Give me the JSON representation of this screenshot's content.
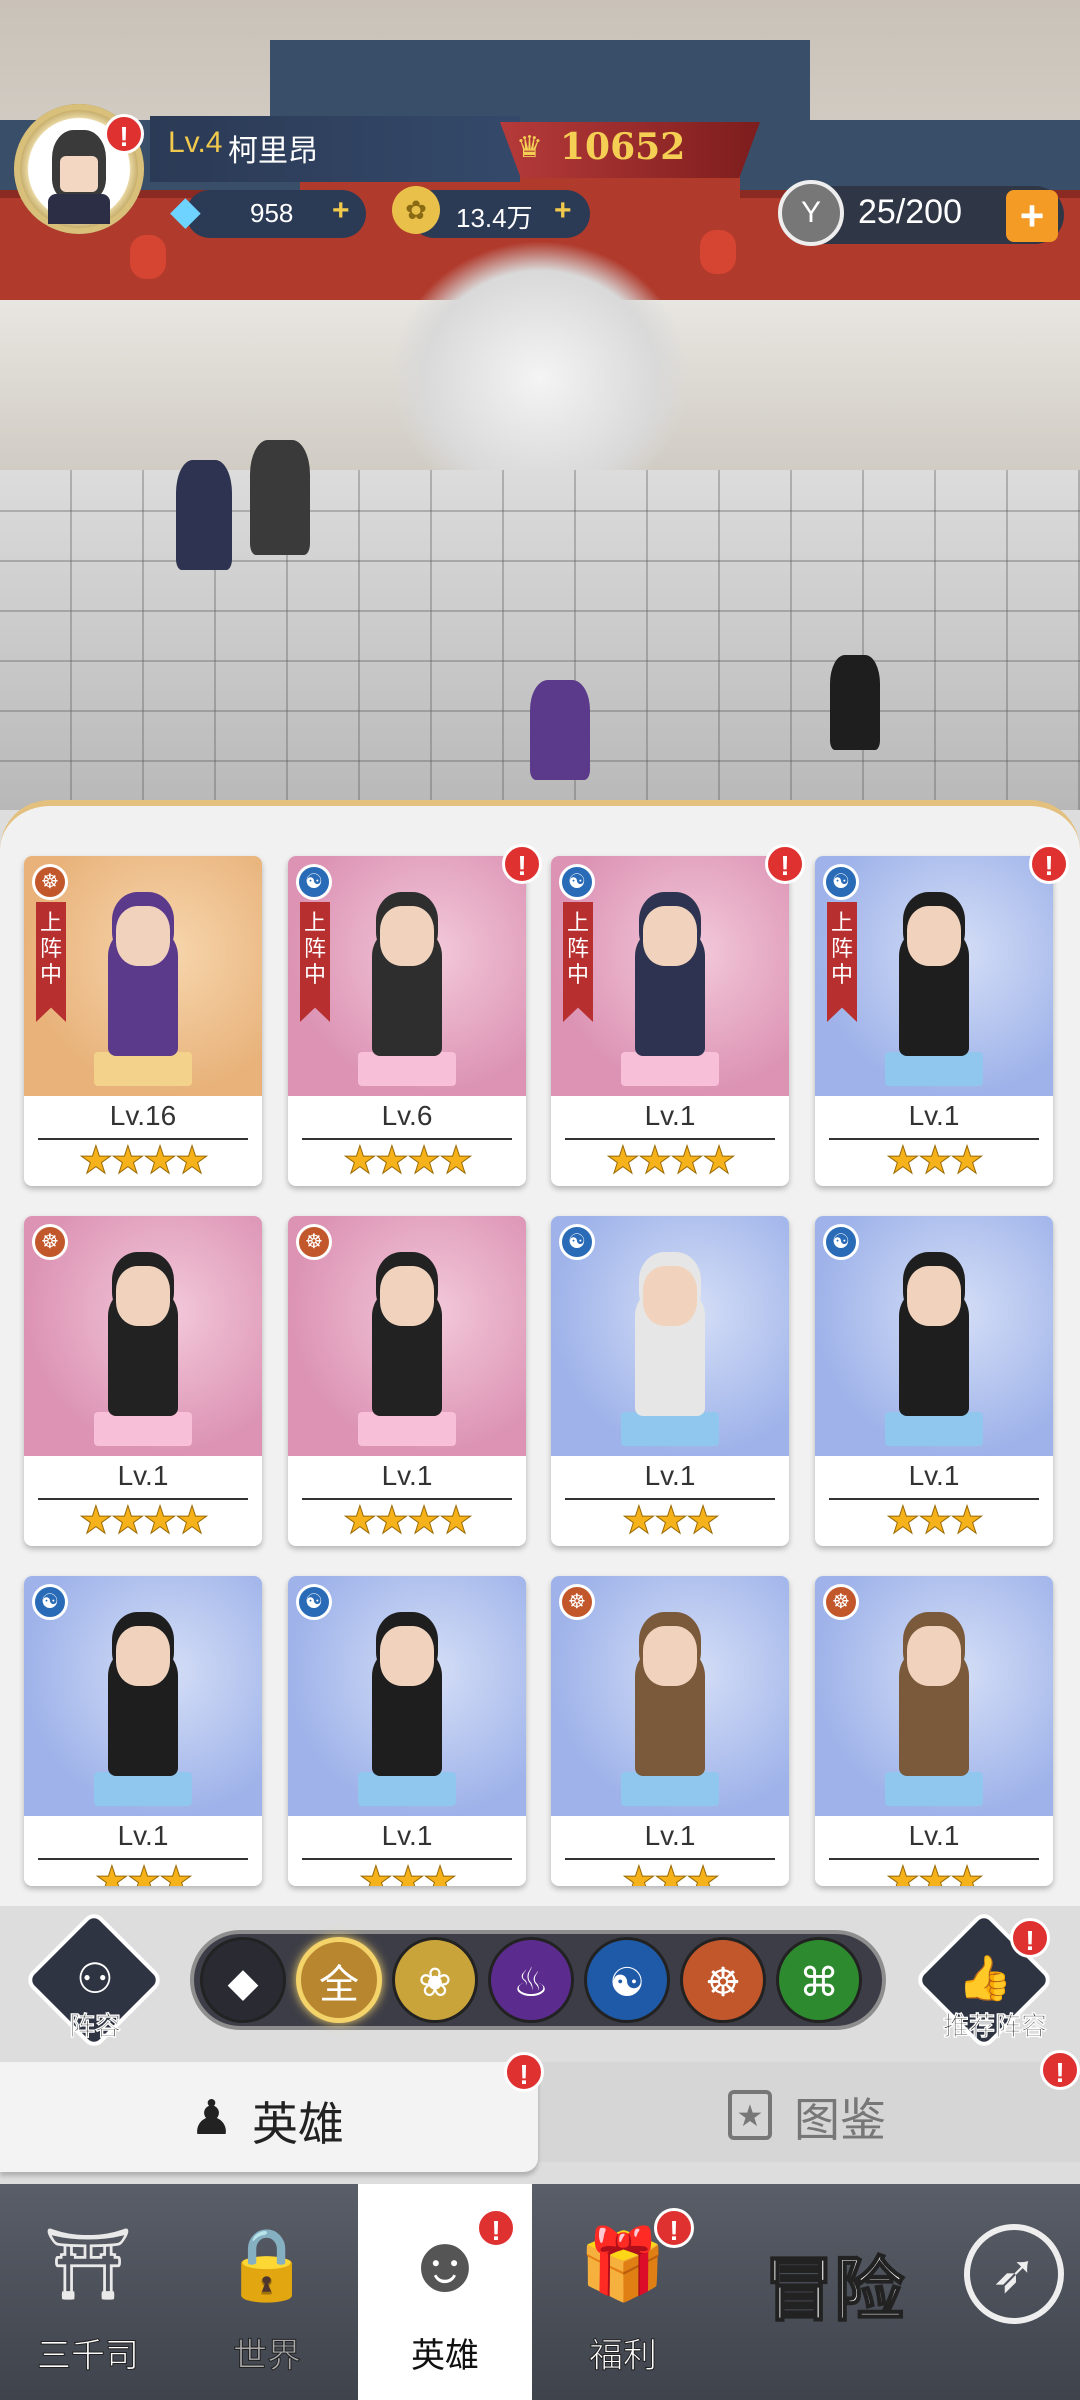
{
  "player": {
    "level_label": "Lv.4",
    "name": "柯里昂",
    "power": "10652",
    "diamonds": "958",
    "coins": "13.4万",
    "energy": "25/200",
    "resource_plus": "+"
  },
  "heroes": [
    {
      "level": "Lv.16",
      "stars": 4,
      "stars_text": "★★★★",
      "faction": "fire",
      "deployed": true,
      "alert": false,
      "theme": "orange",
      "color": "#5b3a8c"
    },
    {
      "level": "Lv.6",
      "stars": 4,
      "stars_text": "★★★★",
      "faction": "water",
      "deployed": true,
      "alert": true,
      "theme": "pink",
      "color": "#2e2e2e"
    },
    {
      "level": "Lv.1",
      "stars": 4,
      "stars_text": "★★★★",
      "faction": "water",
      "deployed": true,
      "alert": true,
      "theme": "pink",
      "color": "#2d3350"
    },
    {
      "level": "Lv.1",
      "stars": 3,
      "stars_text": "★★★",
      "faction": "water",
      "deployed": true,
      "alert": true,
      "theme": "blue",
      "color": "#1e1e1e"
    },
    {
      "level": "Lv.1",
      "stars": 4,
      "stars_text": "★★★★",
      "faction": "fire",
      "deployed": false,
      "alert": false,
      "theme": "pink",
      "color": "#222222"
    },
    {
      "level": "Lv.1",
      "stars": 4,
      "stars_text": "★★★★",
      "faction": "fire",
      "deployed": false,
      "alert": false,
      "theme": "pink",
      "color": "#222222"
    },
    {
      "level": "Lv.1",
      "stars": 3,
      "stars_text": "★★★",
      "faction": "water",
      "deployed": false,
      "alert": false,
      "theme": "blue",
      "color": "#e6e6e6"
    },
    {
      "level": "Lv.1",
      "stars": 3,
      "stars_text": "★★★",
      "faction": "water",
      "deployed": false,
      "alert": false,
      "theme": "blue",
      "color": "#1e1e1e"
    },
    {
      "level": "Lv.1",
      "stars": 3,
      "stars_text": "★★★",
      "faction": "water",
      "deployed": false,
      "alert": false,
      "theme": "blue",
      "color": "#1e1e1e"
    },
    {
      "level": "Lv.1",
      "stars": 3,
      "stars_text": "★★★",
      "faction": "water",
      "deployed": false,
      "alert": false,
      "theme": "blue",
      "color": "#1e1e1e"
    },
    {
      "level": "Lv.1",
      "stars": 3,
      "stars_text": "★★★",
      "faction": "fire",
      "deployed": false,
      "alert": false,
      "theme": "blue",
      "color": "#7a5a3a"
    },
    {
      "level": "Lv.1",
      "stars": 3,
      "stars_text": "★★★",
      "faction": "fire",
      "deployed": false,
      "alert": false,
      "theme": "blue",
      "color": "#7a5a3a"
    }
  ],
  "deployed_label": "上阵中",
  "alert_mark": "!",
  "lineup": {
    "label": "阵容",
    "recommend_label": "推荐阵容"
  },
  "filters": [
    {
      "name": "filter-diamond",
      "glyph": "◆",
      "color": "#2a2a33"
    },
    {
      "name": "filter-all",
      "glyph": "全",
      "color": "#b8862e",
      "active": true
    },
    {
      "name": "filter-lotus",
      "glyph": "❀",
      "color": "#c9a43a"
    },
    {
      "name": "filter-flame",
      "glyph": "♨",
      "color": "#5b2c8e"
    },
    {
      "name": "filter-water",
      "glyph": "☯",
      "color": "#1f5aa8"
    },
    {
      "name": "filter-meditate",
      "glyph": "☸",
      "color": "#c2572c"
    },
    {
      "name": "filter-dna",
      "glyph": "⌘",
      "color": "#2e8a2e"
    }
  ],
  "tabs": {
    "heroes": "英雄",
    "codex": "图鉴"
  },
  "nav": {
    "sanqiansi": "三千司",
    "world": "世界",
    "heroes": "英雄",
    "welfare": "福利",
    "adventure": "冒险"
  }
}
